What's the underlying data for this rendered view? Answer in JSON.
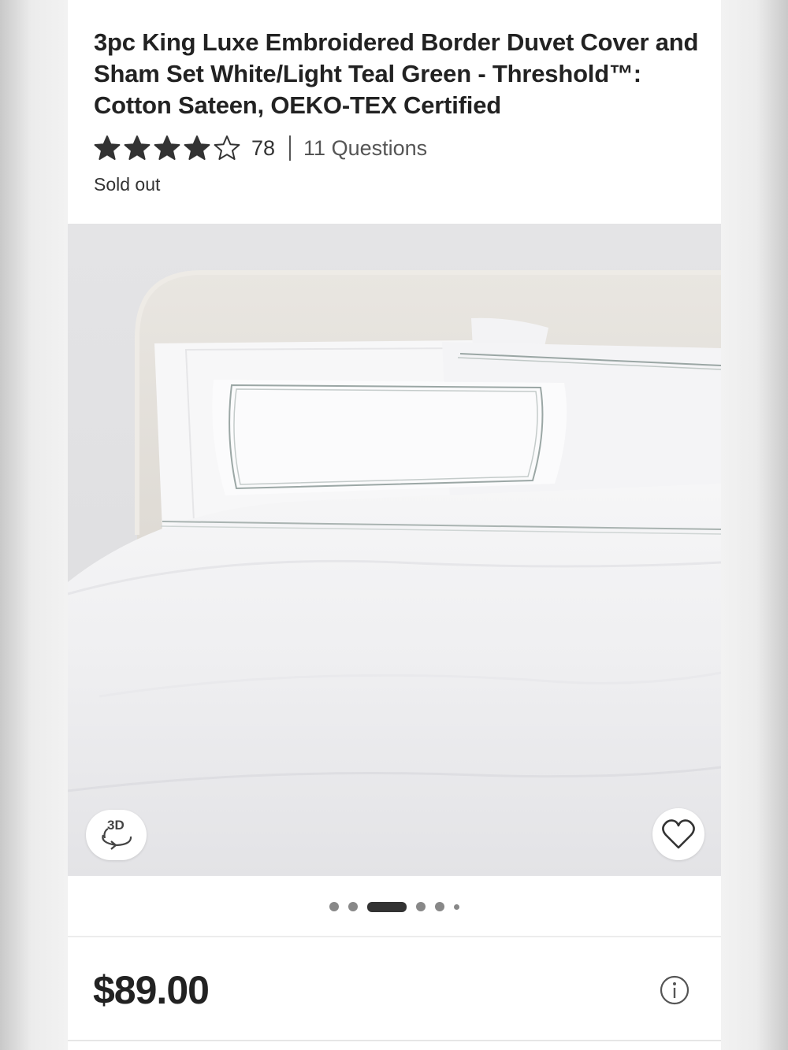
{
  "product": {
    "title": "3pc King Luxe Embroidered Border Duvet Cover and Sham Set White/Light Teal Green - Threshold™: Cotton Sateen, OEKO-TEX Certified",
    "rating": 4,
    "rating_max": 5,
    "review_count": "78",
    "questions_link": "11 Questions",
    "availability": "Sold out",
    "price": "$89.00"
  },
  "gallery": {
    "badge_3d": "3D",
    "image_count": 6,
    "active_index": 2,
    "icons": {
      "view_3d": "rotate-3d-icon",
      "favorite": "heart-icon",
      "info": "info-icon"
    }
  },
  "colors": {
    "text_primary": "#222222",
    "star": "#333333",
    "dot_active": "#333333",
    "dot_inactive": "#888888"
  }
}
